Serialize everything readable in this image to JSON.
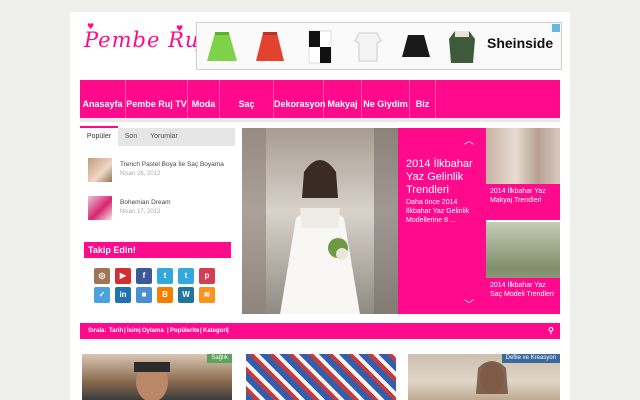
{
  "logo": {
    "text": "Pembe Ruj"
  },
  "ad": {
    "brand": "Sheinside"
  },
  "nav": {
    "items": [
      "Anasayfa",
      "Pembe Ruj TV",
      "Moda",
      "Saç Modelleri",
      "Dekorasyon",
      "Makyaj",
      "Ne Giydim",
      "Biz"
    ]
  },
  "tabs": {
    "items": [
      "Popüler",
      "Son",
      "Yorumlar"
    ],
    "active": "Popüler"
  },
  "posts": [
    {
      "title": "Trench Pastel Boya İle Saç Boyama",
      "date": "Nisan 26, 2012"
    },
    {
      "title": "Bohemian Dream",
      "date": "Nisan 17, 2013"
    }
  ],
  "follow": {
    "title": "Takip Edin!"
  },
  "social_icons": [
    "instagram-icon",
    "youtube-icon",
    "facebook-icon",
    "twitter-icon",
    "pinterest-icon",
    "check-icon",
    "linkedin-icon",
    "blogger-icon",
    "wordpress-icon",
    "rss-icon"
  ],
  "hero": {
    "title": "2014 İlkbahar Yaz Gelinlik Trendleri",
    "excerpt": "Daha önce 2014 İlkbahar Yaz Gelinlik Modellerine 8 ..."
  },
  "side_posts": [
    {
      "title": "2014 İlkbahar Yaz Makyaj Trendleri"
    },
    {
      "title": "2014 İlkbahar Yaz Saç Modeli Trendleri"
    }
  ],
  "sortbar": {
    "label": "Sırala:",
    "options": [
      "Tarih",
      "İsim",
      "Oylama",
      "Popülerite",
      "Kategori"
    ]
  },
  "cards": [
    {
      "tag": "Sağlık",
      "tag_color": "#5aa35a"
    },
    {
      "tag": "",
      "tag_color": ""
    },
    {
      "tag": "Defile ve Kreasyon",
      "tag_color": "#3b6aa0"
    }
  ],
  "colors": {
    "accent": "#ff0a8c",
    "background": "#efefec"
  }
}
